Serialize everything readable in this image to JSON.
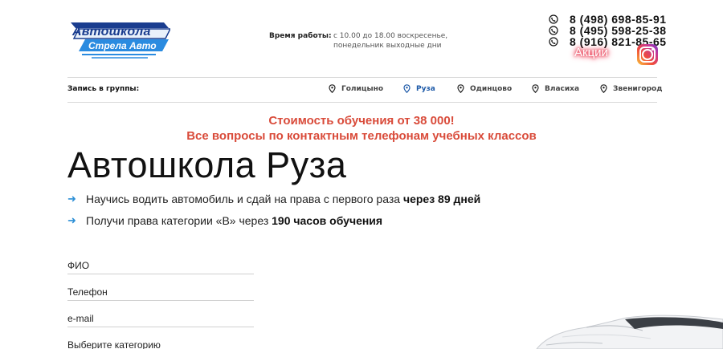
{
  "logo": {
    "line1": "Автошкола",
    "line2": "Стрела Авто",
    "primary_color": "#1a3d8f",
    "accent_color": "#2a8be0"
  },
  "header": {
    "hours_label": "Время работы:",
    "hours_text": "с 10.00 до 18.00 воскресенье, понедельник выходные дни",
    "phones": [
      "8 (498) 698-85-91",
      "8 (495) 598-25-38",
      "8 (916) 821-85-65"
    ],
    "phone_icon": "whatsapp-phone-icon",
    "promo_link": "Акции",
    "promo_glow_color": "#e8334b",
    "instagram_icon": "instagram-icon"
  },
  "nav": {
    "label": "Запись в группы:",
    "items": [
      {
        "label": "Голицыно",
        "active": false
      },
      {
        "label": "Руза",
        "active": true
      },
      {
        "label": "Одинцово",
        "active": false
      },
      {
        "label": "Власиха",
        "active": false
      },
      {
        "label": "Звенигород",
        "active": false
      }
    ],
    "active_color": "#1e5aa8",
    "icon": "location-pin-icon"
  },
  "promo": {
    "line1": "Стоимость обучения от 38 000!",
    "line2": "Все вопросы по контактным телефонам учебных классов",
    "color": "#d94b3a"
  },
  "main": {
    "title": "Автошкола Руза",
    "bullets": [
      {
        "text": "Научись водить автомобиль и сдай на права с первого раза ",
        "bold": "через 89 дней"
      },
      {
        "text": "Получи права категории «В» через ",
        "bold": "190 часов обучения"
      }
    ],
    "bullet_icon": "arrow-right-icon",
    "bullet_color": "#2d8fd6"
  },
  "form": {
    "name_placeholder": "ФИО",
    "phone_placeholder": "Телефон",
    "email_placeholder": "e-mail",
    "category_placeholder": "Выберите категорию"
  },
  "car_image": "car-image"
}
